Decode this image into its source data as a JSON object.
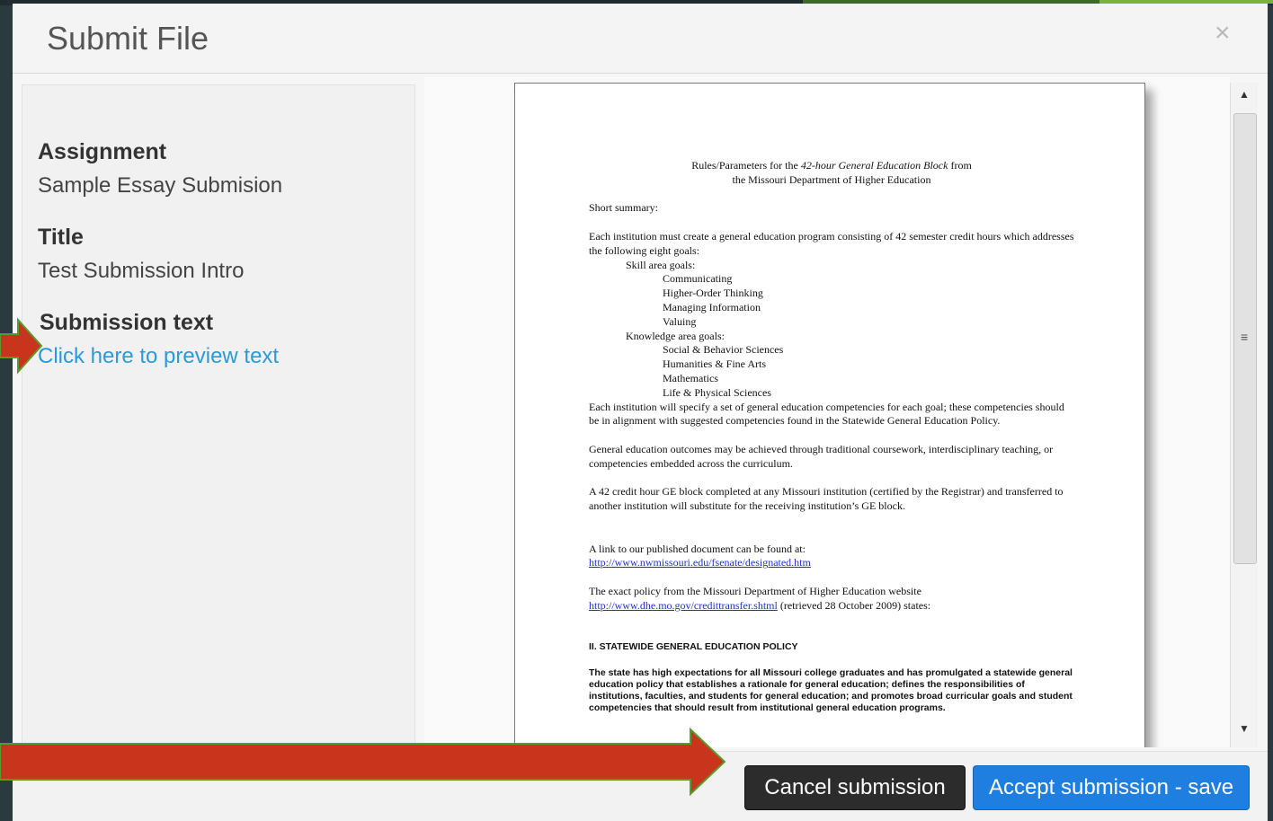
{
  "dialog": {
    "title": "Submit File",
    "close_glyph": "×"
  },
  "sidebar": {
    "assignment_label": "Assignment",
    "assignment_value": "Sample Essay Submision",
    "title_label": "Title",
    "title_value": "Test Submission Intro",
    "submission_label": "Submission text",
    "preview_link": "Click here to preview text"
  },
  "document": {
    "heading_line1_pre": "Rules/Parameters for the ",
    "heading_line1_em": "42-hour General Education Block",
    "heading_line1_post": " from",
    "heading_line2": "the Missouri Department of Higher Education",
    "short_summary": "Short summary:",
    "para1": "Each institution must create a general education program consisting of 42 semester credit hours which addresses the following eight goals:",
    "skill_goals": "Skill area goals:",
    "skills": [
      "Communicating",
      "Higher-Order Thinking",
      "Managing Information",
      "Valuing"
    ],
    "knowledge_goals": "Knowledge area goals:",
    "knowledge": [
      "Social & Behavior Sciences",
      "Humanities & Fine Arts",
      "Mathematics",
      "Life & Physical Sciences"
    ],
    "para2": "Each institution will specify a set of general education competencies for each goal; these competencies should be in alignment with suggested competencies found in the Statewide General Education Policy.",
    "para3": "General education outcomes may be achieved through traditional coursework, interdisciplinary teaching, or competencies embedded across the curriculum.",
    "para4": "A 42 credit hour GE block completed at any Missouri institution (certified by the Registrar) and transferred to another institution will substitute for the receiving institution’s GE block.",
    "link_intro": "A link to our published document can be found at:",
    "link1": "http://www.nwmissouri.edu/fsenate/designated.htm",
    "policy_intro": "The exact policy from the Missouri Department of Higher Education website",
    "link2": "http://www.dhe.mo.gov/credittransfer.shtml",
    "link2_suffix": " (retrieved 28 October 2009) states:",
    "section_heading": "II. STATEWIDE GENERAL EDUCATION POLICY",
    "section_para": "The state has high expectations for all Missouri college graduates and has promulgated a statewide general education policy that establishes a rationale for general education; defines the responsibilities of institutions, faculties, and students for general education; and promotes broad curricular goals and student competencies that should result from institutional general education programs."
  },
  "scrollbar": {
    "up_glyph": "▲",
    "down_glyph": "▼",
    "grip_glyph": "≡"
  },
  "footer": {
    "cancel_label": "Cancel submission",
    "accept_label": "Accept submission - save"
  },
  "colors": {
    "accent_blue": "#1f7fe0",
    "link_blue": "#2a9bd8",
    "arrow_red": "#c8341c",
    "arrow_outline": "#5a9a2a"
  }
}
